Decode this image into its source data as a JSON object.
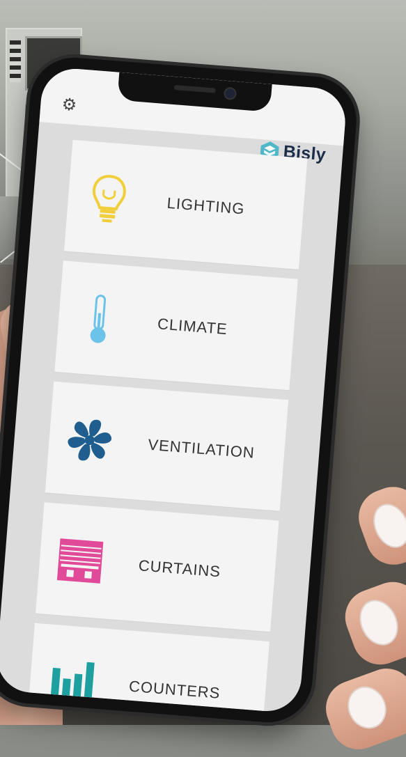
{
  "app": {
    "brand_name": "Bisly",
    "brand_color": "#1c2e4a",
    "accent_color": "#4fb7c8"
  },
  "header": {
    "settings_icon": "gear-icon"
  },
  "menu": {
    "items": [
      {
        "label": "LIGHTING",
        "icon": "lightbulb-icon",
        "color": "#f0cf3b"
      },
      {
        "label": "CLIMATE",
        "icon": "thermometer-icon",
        "color": "#6cc3ea"
      },
      {
        "label": "VENTILATION",
        "icon": "fan-icon",
        "color": "#1f5e8e"
      },
      {
        "label": "CURTAINS",
        "icon": "curtains-icon",
        "color": "#e04a99"
      },
      {
        "label": "COUNTERS",
        "icon": "bar-chart-icon",
        "color": "#1e9fa0"
      }
    ]
  }
}
